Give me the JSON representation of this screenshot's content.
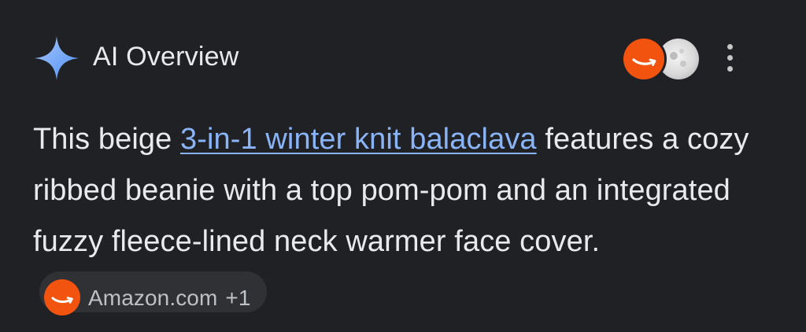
{
  "overview": {
    "title": "AI Overview",
    "icon": "sparkle-icon",
    "accent": "#8ab4f8"
  },
  "sources": {
    "icons": [
      "amazon-icon",
      "moon-globe-icon"
    ],
    "amazon_color": "#f2530f"
  },
  "menu": {
    "icon": "more-vert-icon"
  },
  "answer": {
    "prefix": "This beige ",
    "link": "3-in-1 winter knit balaclava",
    "suffix": " features a cozy ribbed beanie with a top pom-pom and an integrated fuzzy fleece-lined neck warmer face cover."
  },
  "citation": {
    "label": "Amazon.com",
    "count": "+1"
  }
}
